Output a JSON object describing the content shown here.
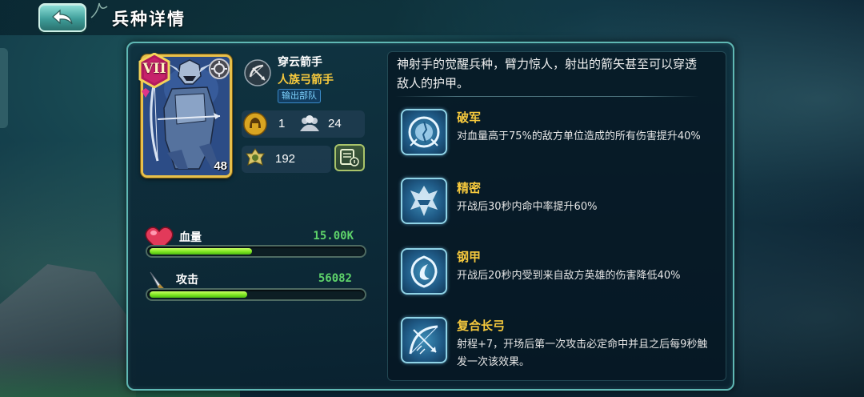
{
  "header": {
    "title": "兵种详情"
  },
  "unit": {
    "rank": "VII",
    "level": "48",
    "name": "穿云箭手",
    "type": "人族弓箭手",
    "tag": "输出部队",
    "leadership": "1",
    "troops": "24",
    "power": "192"
  },
  "stats": {
    "hp_label": "血量",
    "hp_value": "15.00K",
    "hp_fill_pct": 48,
    "atk_label": "攻击",
    "atk_value": "56082",
    "atk_fill_pct": 46
  },
  "description": "神射手的觉醒兵种，臂力惊人，射出的箭矢甚至可以穿透敌人的护甲。",
  "skills": [
    {
      "name": "破军",
      "desc": "对血量高于75%的敌方单位造成的所有伤害提升40%",
      "icon": "shattered-shield-icon"
    },
    {
      "name": "精密",
      "desc": "开战后30秒内命中率提升60%",
      "icon": "crested-helmet-icon"
    },
    {
      "name": "钢甲",
      "desc": "开战后20秒内受到来自敌方英雄的伤害降低40%",
      "icon": "crescent-shield-icon"
    },
    {
      "name": "复合长弓",
      "desc": "射程+7，开场后第一次攻击必定命中并且之后每9秒触发一次该效果。",
      "icon": "longbow-icon"
    }
  ],
  "colors": {
    "accent_gold": "#f6c93d",
    "bar_green": "#5ed36a",
    "panel_border": "#5fb8b4"
  }
}
